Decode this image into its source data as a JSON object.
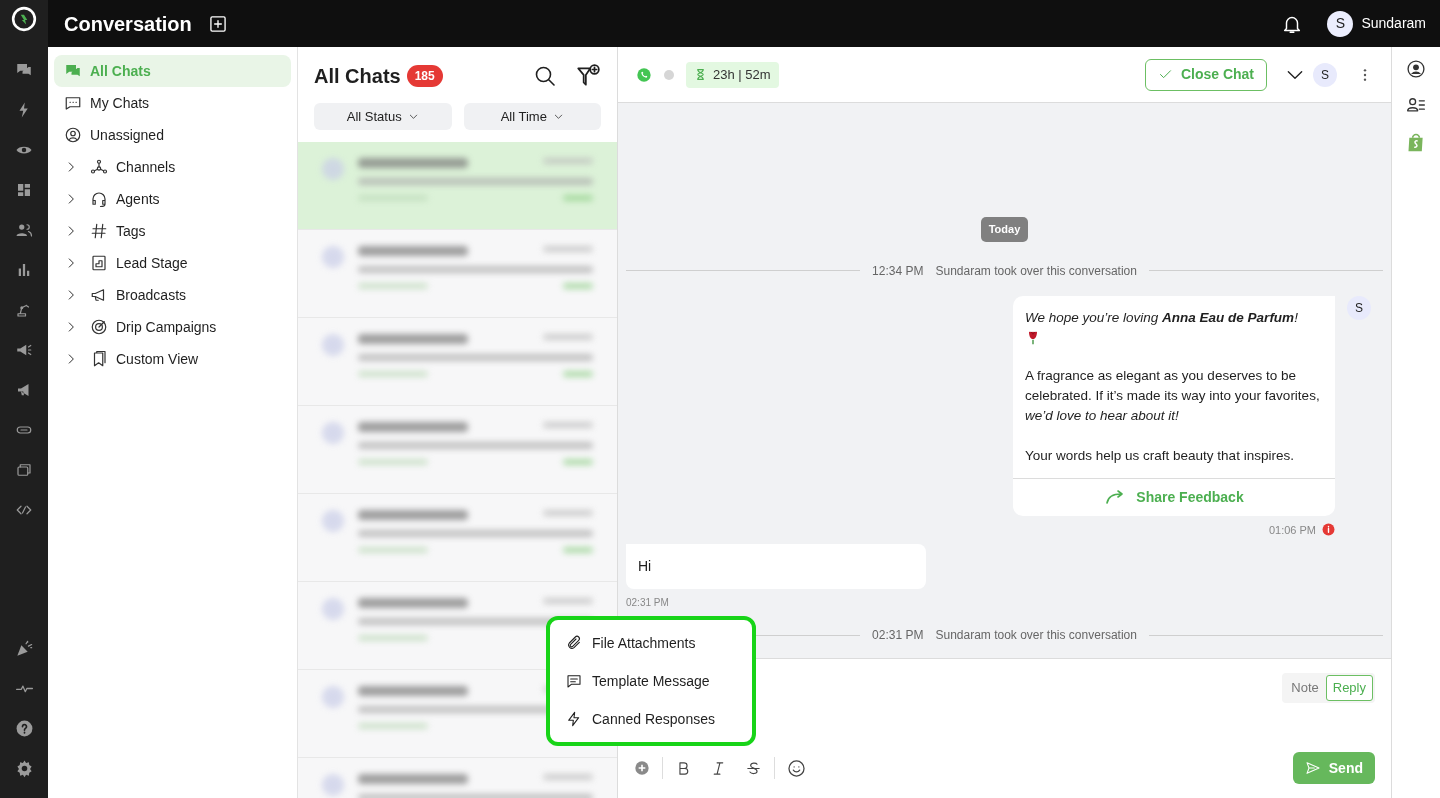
{
  "topbar": {
    "title": "Conversation",
    "user": {
      "initial": "S",
      "name": "Sundaram"
    }
  },
  "sidebar": {
    "items": [
      {
        "label": "All Chats",
        "selected": true
      },
      {
        "label": "My Chats",
        "selected": false
      },
      {
        "label": "Unassigned",
        "selected": false
      },
      {
        "label": "Channels",
        "selected": false,
        "expanded": false
      },
      {
        "label": "Agents",
        "selected": false,
        "expanded": false
      },
      {
        "label": "Tags",
        "selected": false,
        "expanded": false
      },
      {
        "label": "Lead Stage",
        "selected": false,
        "expanded": false
      },
      {
        "label": "Broadcasts",
        "selected": false,
        "expanded": false
      },
      {
        "label": "Drip Campaigns",
        "selected": false,
        "expanded": false
      },
      {
        "label": "Custom View",
        "selected": false,
        "expanded": false
      }
    ]
  },
  "chat_list": {
    "title": "All Chats",
    "count": "185",
    "filters": [
      "All Status",
      "All Time"
    ],
    "rows": [
      {
        "selected": true
      },
      {
        "selected": false
      },
      {
        "selected": false
      },
      {
        "selected": false
      },
      {
        "selected": false
      },
      {
        "selected": false
      },
      {
        "selected": false
      },
      {
        "selected": false
      }
    ]
  },
  "chat_header": {
    "online": false,
    "timer": "23h | 52m",
    "close_button": "Close Chat",
    "agent_initial": "S"
  },
  "messages": [
    {
      "kind": "date",
      "text": "Today"
    },
    {
      "kind": "event",
      "time": "12:34 PM",
      "text": "Sundaram took over this conversation"
    },
    {
      "kind": "outgoing",
      "paragraphs": [
        "We hope you’re loving **Anna Eau de Parfum**!",
        "A fragrance as elegant as you deserves to be celebrated. If it’s made its way into your favorites, *we’d love to hear about it!*",
        "Your words help us craft beauty that inspires."
      ],
      "button": "Share Feedback",
      "time": "01:06 PM",
      "failed": true,
      "avatar": "S"
    },
    {
      "kind": "incoming",
      "text": "Hi",
      "time": "02:31 PM"
    },
    {
      "kind": "event",
      "time": "02:31 PM",
      "text": "Sundaram took over this conversation"
    }
  ],
  "composer": {
    "modes": [
      {
        "label": "Note",
        "selected": false
      },
      {
        "label": "Reply",
        "selected": true
      }
    ],
    "send": "Send"
  },
  "attach_menu": {
    "items": [
      "File Attachments",
      "Template Message",
      "Canned Responses"
    ]
  }
}
